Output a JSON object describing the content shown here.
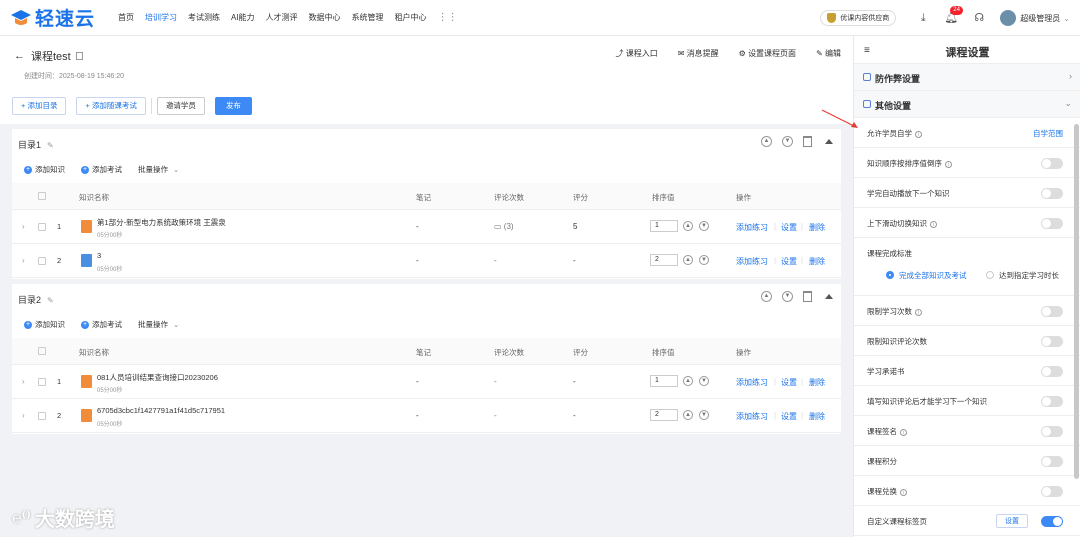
{
  "app": {
    "logo_text": "轻速云"
  },
  "nav": [
    "首页",
    "培训学习",
    "考试测练",
    "AI能力",
    "人才测评",
    "数据中心",
    "系统管理",
    "租户中心"
  ],
  "nav_active": 1,
  "topbar": {
    "app_badge": "优课内容供应商",
    "notif_count": "24",
    "user": "超级管理员"
  },
  "course": {
    "title": "课程test",
    "created": "创建时间：2025-08-19 15:46:20"
  },
  "header_actions": [
    "课程入口",
    "消息提醒",
    "设置课程页面",
    "编辑"
  ],
  "buttons": {
    "add_dir": "添加目录",
    "add_exam": "添加随课考试",
    "invite": "邀请学员",
    "publish": "发布"
  },
  "dir_actions": {
    "add_knowledge": "添加知识",
    "add_exam": "添加考试",
    "batch": "批量操作"
  },
  "columns": [
    "知识名称",
    "笔记",
    "评论次数",
    "评分",
    "排序值",
    "操作"
  ],
  "row_actions": [
    "添加练习",
    "设置",
    "删除"
  ],
  "directories": [
    {
      "title": "目录1",
      "rows": [
        {
          "idx": "1",
          "name": "第1部分-新型电力系统政策环境 王震泉",
          "time": "05分00秒",
          "notes": "-",
          "comments": "(3)",
          "score": "5",
          "order": "1",
          "icon": "orange"
        },
        {
          "idx": "2",
          "name": "3",
          "time": "05分00秒",
          "notes": "-",
          "comments": "-",
          "score": "-",
          "order": "2",
          "icon": "blue"
        }
      ]
    },
    {
      "title": "目录2",
      "rows": [
        {
          "idx": "1",
          "name": "081人员培训结果查询接口20230206",
          "time": "05分00秒",
          "notes": "-",
          "comments": "-",
          "score": "-",
          "order": "1",
          "icon": "orange"
        },
        {
          "idx": "2",
          "name": "6705d3cbc1f1427791a1f41d5c717951",
          "time": "05分00秒",
          "notes": "-",
          "comments": "-",
          "score": "-",
          "order": "2",
          "icon": "orange"
        }
      ]
    }
  ],
  "panel": {
    "title": "课程设置",
    "sections": [
      "防作弊设置",
      "其他设置"
    ],
    "allow_self": "允许学员自学",
    "self_range": "自学范围",
    "settings": [
      {
        "label": "知识顺序按排序值倒序",
        "info": true,
        "on": false
      },
      {
        "label": "学完自动播放下一个知识",
        "info": false,
        "on": false
      },
      {
        "label": "上下滑动切换知识",
        "info": true,
        "on": false
      }
    ],
    "complete_label": "课程完成标准",
    "complete_opts": [
      "完成全部知识及考试",
      "达到指定学习时长"
    ],
    "settings2": [
      {
        "label": "限制学习次数",
        "info": true,
        "on": false
      },
      {
        "label": "限制知识评论次数",
        "info": false,
        "on": false
      },
      {
        "label": "学习承诺书",
        "info": false,
        "on": false
      },
      {
        "label": "填写知识评论后才能学习下一个知识",
        "info": false,
        "on": false
      },
      {
        "label": "课程签名",
        "info": true,
        "on": false
      },
      {
        "label": "课程积分",
        "info": false,
        "on": false
      },
      {
        "label": "课程兑换",
        "info": true,
        "on": false
      }
    ],
    "custom_tag": "自定义课程标签页",
    "custom_btn": "设置"
  },
  "watermark": "大数跨境"
}
